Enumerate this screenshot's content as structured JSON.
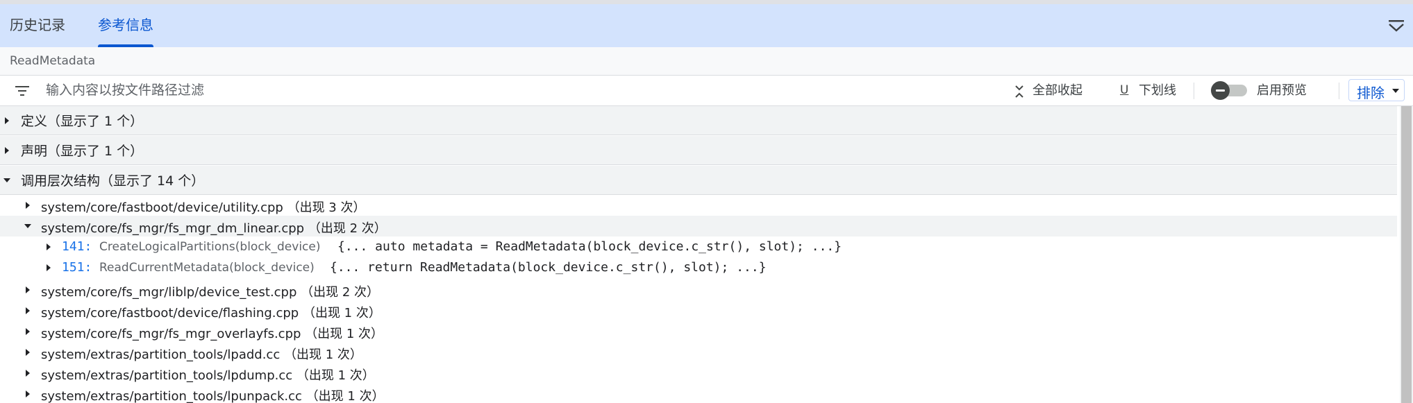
{
  "tabs": [
    {
      "label": "历史记录",
      "active": false
    },
    {
      "label": "参考信息",
      "active": true
    }
  ],
  "breadcrumb": "ReadMetadata",
  "toolbar": {
    "filter_placeholder": "输入内容以按文件路径过滤",
    "collapse_all_label": "全部收起",
    "underline_label": "下划线",
    "preview_label": "启用预览",
    "preview_enabled": false,
    "sort_label": "排除"
  },
  "sections": [
    {
      "label": "定义（显示了 1 个）",
      "expanded": false
    },
    {
      "label": "声明（显示了 1 个）",
      "expanded": false
    },
    {
      "label": "调用层次结构（显示了 14 个）",
      "expanded": true
    }
  ],
  "files": [
    {
      "path": "system/core/fastboot/device/utility.cpp",
      "count": "（出现 3 次）",
      "expanded": false
    },
    {
      "path": "system/core/fs_mgr/fs_mgr_dm_linear.cpp",
      "count": "（出现 2 次）",
      "expanded": true
    },
    {
      "path": "system/core/fs_mgr/liblp/device_test.cpp",
      "count": "（出现 2 次）",
      "expanded": false
    },
    {
      "path": "system/core/fastboot/device/flashing.cpp",
      "count": "（出现 1 次）",
      "expanded": false
    },
    {
      "path": "system/core/fs_mgr/fs_mgr_overlayfs.cpp",
      "count": "（出现 1 次）",
      "expanded": false
    },
    {
      "path": "system/extras/partition_tools/lpadd.cc",
      "count": "（出现 1 次）",
      "expanded": false
    },
    {
      "path": "system/extras/partition_tools/lpdump.cc",
      "count": "（出现 1 次）",
      "expanded": false
    },
    {
      "path": "system/extras/partition_tools/lpunpack.cc",
      "count": "（出现 1 次）",
      "expanded": false
    }
  ],
  "references": [
    {
      "line": "141:",
      "function": "CreateLogicalPartitions(block_device)",
      "code": "{... auto metadata = ReadMetadata(block_device.c_str(), slot); ...}"
    },
    {
      "line": "151:",
      "function": "ReadCurrentMetadata(block_device)",
      "code": "{... return ReadMetadata(block_device.c_str(), slot); ...}"
    }
  ],
  "colors": {
    "tab_bar": "#d3e3fd",
    "accent": "#0b57d0",
    "line_number": "#1a73e8"
  }
}
